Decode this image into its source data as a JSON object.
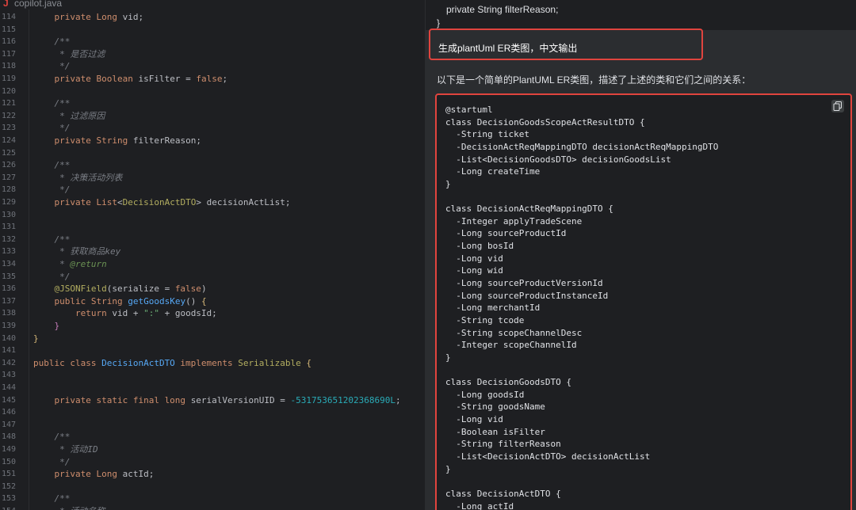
{
  "editor": {
    "tab": {
      "icon_letter": "J",
      "filename": "copilot.java"
    },
    "lines": [
      {
        "n": "114",
        "tokens": [
          [
            "t-type",
            "    private "
          ],
          [
            "t-type",
            "Long"
          ],
          [
            "",
            " vid;"
          ]
        ]
      },
      {
        "n": "115",
        "tokens": []
      },
      {
        "n": "116",
        "tokens": [
          [
            "t-cm",
            "    /**"
          ]
        ]
      },
      {
        "n": "117",
        "tokens": [
          [
            "t-cm",
            "     * 是否过滤"
          ]
        ]
      },
      {
        "n": "118",
        "tokens": [
          [
            "t-cm",
            "     */"
          ]
        ]
      },
      {
        "n": "119",
        "tokens": [
          [
            "t-kw",
            "    private "
          ],
          [
            "t-type",
            "Boolean"
          ],
          [
            "",
            " isFilter = "
          ],
          [
            "t-kw",
            "false"
          ],
          [
            "",
            ";"
          ]
        ]
      },
      {
        "n": "120",
        "tokens": []
      },
      {
        "n": "121",
        "tokens": [
          [
            "t-cm",
            "    /**"
          ]
        ]
      },
      {
        "n": "122",
        "tokens": [
          [
            "t-cm",
            "     * 过滤原因"
          ]
        ]
      },
      {
        "n": "123",
        "tokens": [
          [
            "t-cm",
            "     */"
          ]
        ]
      },
      {
        "n": "124",
        "tokens": [
          [
            "t-kw",
            "    private "
          ],
          [
            "t-type",
            "String"
          ],
          [
            "",
            " filterReason;"
          ]
        ]
      },
      {
        "n": "125",
        "tokens": []
      },
      {
        "n": "126",
        "tokens": [
          [
            "t-cm",
            "    /**"
          ]
        ]
      },
      {
        "n": "127",
        "tokens": [
          [
            "t-cm",
            "     * 决策活动列表"
          ]
        ]
      },
      {
        "n": "128",
        "tokens": [
          [
            "t-cm",
            "     */"
          ]
        ]
      },
      {
        "n": "129",
        "tokens": [
          [
            "t-kw",
            "    private "
          ],
          [
            "t-type",
            "List"
          ],
          [
            "",
            "<"
          ],
          [
            "t-an",
            "DecisionActDTO"
          ],
          [
            "",
            "> decisionActList;"
          ]
        ]
      },
      {
        "n": "130",
        "tokens": []
      },
      {
        "n": "131",
        "tokens": []
      },
      {
        "n": "132",
        "tokens": [
          [
            "t-cm",
            "    /**"
          ]
        ]
      },
      {
        "n": "133",
        "tokens": [
          [
            "t-cm",
            "     * 获取商品key"
          ]
        ]
      },
      {
        "n": "134",
        "tokens": [
          [
            "t-cm",
            "     * "
          ],
          [
            "t-doc",
            "@return"
          ]
        ]
      },
      {
        "n": "135",
        "tokens": [
          [
            "t-cm",
            "     */"
          ]
        ]
      },
      {
        "n": "136",
        "tokens": [
          [
            "t-ann",
            "    @JSONField"
          ],
          [
            "",
            "(serialize = "
          ],
          [
            "t-kw",
            "false"
          ],
          [
            "",
            ")"
          ]
        ]
      },
      {
        "n": "137",
        "tokens": [
          [
            "t-kw",
            "    public "
          ],
          [
            "t-type",
            "String"
          ],
          [
            "t-fn",
            " getGoodsKey"
          ],
          [
            "",
            "() "
          ],
          [
            "t-br",
            "{"
          ]
        ]
      },
      {
        "n": "138",
        "tokens": [
          [
            "t-kw",
            "        return"
          ],
          [
            "",
            " vid + "
          ],
          [
            "t-str",
            "\":\""
          ],
          [
            "",
            " + goodsId;"
          ]
        ]
      },
      {
        "n": "139",
        "tokens": [
          [
            "t-gen",
            "    }"
          ]
        ]
      },
      {
        "n": "140",
        "tokens": [
          [
            "t-br",
            "}"
          ]
        ]
      },
      {
        "n": "141",
        "tokens": []
      },
      {
        "n": "142",
        "tokens": [
          [
            "t-kw",
            "public class "
          ],
          [
            "t-fn",
            "DecisionActDTO"
          ],
          [
            "t-kw",
            " implements "
          ],
          [
            "t-an",
            "Serializable"
          ],
          [
            "",
            " "
          ],
          [
            "t-br",
            "{"
          ]
        ]
      },
      {
        "n": "143",
        "tokens": []
      },
      {
        "n": "144",
        "tokens": []
      },
      {
        "n": "145",
        "tokens": [
          [
            "t-kw",
            "    private static final long "
          ],
          [
            "",
            "serialVersionUID = "
          ],
          [
            "t-num",
            "-5317536512023686 90L"
          ],
          [
            "",
            ";"
          ]
        ]
      },
      {
        "n": "146",
        "tokens": []
      },
      {
        "n": "147",
        "tokens": []
      },
      {
        "n": "148",
        "tokens": [
          [
            "t-cm",
            "    /**"
          ]
        ]
      },
      {
        "n": "149",
        "tokens": [
          [
            "t-cm",
            "     * 活动ID"
          ]
        ]
      },
      {
        "n": "150",
        "tokens": [
          [
            "t-cm",
            "     */"
          ]
        ]
      },
      {
        "n": "151",
        "tokens": [
          [
            "t-kw",
            "    private "
          ],
          [
            "t-type",
            "Long"
          ],
          [
            "",
            " actId;"
          ]
        ]
      },
      {
        "n": "152",
        "tokens": []
      },
      {
        "n": "153",
        "tokens": [
          [
            "t-cm",
            "    /**"
          ]
        ]
      },
      {
        "n": "154",
        "tokens": [
          [
            "t-cm",
            "     * 活动名称"
          ]
        ]
      }
    ]
  },
  "chat": {
    "previous": {
      "line1": "private String filterReason;",
      "line2": "}"
    },
    "user_message": "生成plantUml ER类图，中文输出",
    "answer_intro": "以下是一个简单的PlantUML ER类图，描述了上述的类和它们之间的关系：",
    "copy_button_icon": "copy-icon",
    "uml_lines": [
      "@startuml",
      "class DecisionGoodsScopeActResultDTO {",
      "  -String ticket",
      "  -DecisionActReqMappingDTO decisionActReqMappingDTO",
      "  -List<DecisionGoodsDTO> decisionGoodsList",
      "  -Long createTime",
      "}",
      "",
      "class DecisionActReqMappingDTO {",
      "  -Integer applyTradeScene",
      "  -Long sourceProductId",
      "  -Long bosId",
      "  -Long vid",
      "  -Long wid",
      "  -Long sourceProductVersionId",
      "  -Long sourceProductInstanceId",
      "  -Long merchantId",
      "  -String tcode",
      "  -String scopeChannelDesc",
      "  -Integer scopeChannelId",
      "}",
      "",
      "class DecisionGoodsDTO {",
      "  -Long goodsId",
      "  -String goodsName",
      "  -Long vid",
      "  -Boolean isFilter",
      "  -String filterReason",
      "  -List<DecisionActDTO> decisionActList",
      "}",
      "",
      "class DecisionActDTO {",
      "  -Long actId"
    ]
  },
  "colors": {
    "editor_bg": "#1e1f22",
    "panel_bg": "#2b2d30",
    "highlight_border": "#e0443e",
    "keyword": "#cf8e6d",
    "comment": "#7a7e85",
    "class_name": "#56a8f5",
    "number": "#2aacb8"
  }
}
